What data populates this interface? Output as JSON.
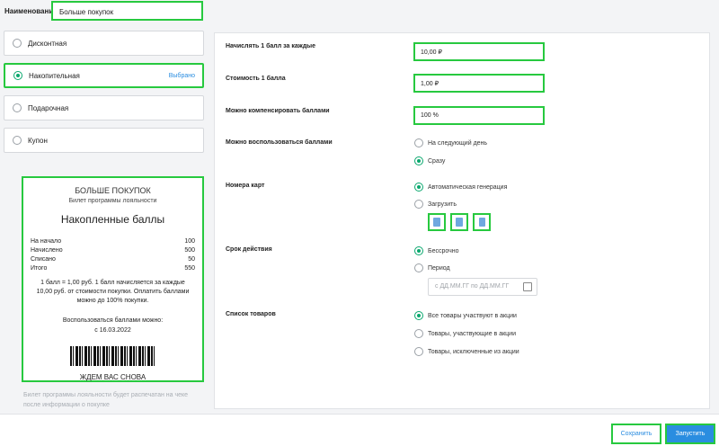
{
  "name_field": {
    "label": "Наименование",
    "value": "Больше покупок"
  },
  "program_types": [
    {
      "label": "Дисконтная",
      "selected": false
    },
    {
      "label": "Накопительная",
      "selected": true,
      "badge": "Выбрано"
    },
    {
      "label": "Подарочная",
      "selected": false
    },
    {
      "label": "Купон",
      "selected": false
    }
  ],
  "ticket": {
    "title": "БОЛЬШЕ ПОКУПОК",
    "subtitle": "Билет программы лояльности",
    "heading": "Накопленные баллы",
    "rows": [
      {
        "label": "На начало",
        "value": "100"
      },
      {
        "label": "Начислено",
        "value": "500"
      },
      {
        "label": "Списано",
        "value": "50"
      },
      {
        "label": "Итого",
        "value": "550"
      }
    ],
    "note": "1 балл = 1,00 руб. 1 балл начисляется за каждые 10,00 руб. от стоимости покупки. Оплатить баллами можно до 100% покупки.",
    "use_label": "Воспользоваться баллами можно:",
    "use_date": "с 16.03.2022",
    "footer": "ЖДЕМ ВАС СНОВА"
  },
  "print_note": "Билет программы лояльности будет распечатан на чеке после информации о покупке",
  "settings": {
    "accrual_label": "Начислять 1 балл за каждые",
    "accrual_value": "10,00 ₽",
    "cost_label": "Стоимость 1 балла",
    "cost_value": "1,00 ₽",
    "compensate_label": "Можно компенсировать баллами",
    "compensate_value": "100 %",
    "use_label": "Можно воспользоваться баллами",
    "use_options": [
      {
        "label": "На следующий день",
        "selected": false
      },
      {
        "label": "Сразу",
        "selected": true
      }
    ],
    "cards_label": "Номера карт",
    "cards_options": [
      {
        "label": "Автоматическая генерация",
        "selected": true
      },
      {
        "label": "Загрузить",
        "selected": false
      }
    ],
    "upload_icons": [
      "file-upload-icon",
      "file-download-icon",
      "trash-icon"
    ],
    "validity_label": "Срок действия",
    "validity_options": [
      {
        "label": "Бессрочно",
        "selected": true
      },
      {
        "label": "Период",
        "selected": false
      }
    ],
    "period_placeholder": "с ДД.ММ.ГГ   по ДД.ММ.ГГ",
    "goods_label": "Список товаров",
    "goods_options": [
      {
        "label": "Все товары участвуют в акции",
        "selected": true
      },
      {
        "label": "Товары, участвующие в акции",
        "selected": false
      },
      {
        "label": "Товары, исключенные из акции",
        "selected": false
      }
    ]
  },
  "actions": {
    "save": "Сохранить",
    "run": "Запустить"
  },
  "colors": {
    "accent": "#2a8de0",
    "radio_on": "#0aa86e",
    "highlight": "#27c93f"
  }
}
